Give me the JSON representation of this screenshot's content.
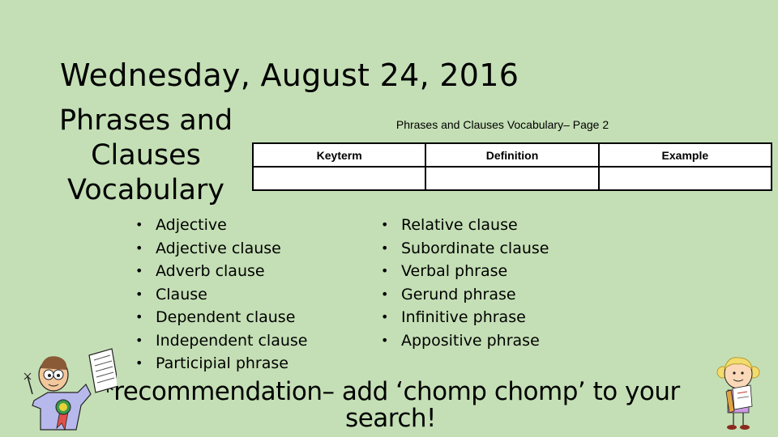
{
  "slide": {
    "date_title": "Wednesday, August 24, 2016",
    "side_title": "Phrases and Clauses Vocabulary",
    "worksheet": {
      "caption": "Phrases and Clauses Vocabulary– Page 2",
      "columns": [
        "Keyterm",
        "Definition",
        "Example"
      ],
      "rows": [
        [
          "",
          "",
          ""
        ]
      ]
    },
    "terms_left": [
      "Adjective",
      "Adjective clause",
      "Adverb clause",
      "Clause",
      "Dependent clause",
      "Independent clause",
      "Participial phrase"
    ],
    "terms_right": [
      "Relative clause",
      "Subordinate clause",
      "Verbal phrase",
      "Gerund phrase",
      "Infinitive phrase",
      "Appositive phrase"
    ],
    "bullet_glyph": "•",
    "recommendation": "*recommendation– add ‘chomp chomp’ to your search!",
    "clipart": {
      "left": "boy-with-award-ribbon",
      "right": "girl-holding-book"
    },
    "colors": {
      "background": "#c4dfb5",
      "text": "#000000"
    }
  }
}
